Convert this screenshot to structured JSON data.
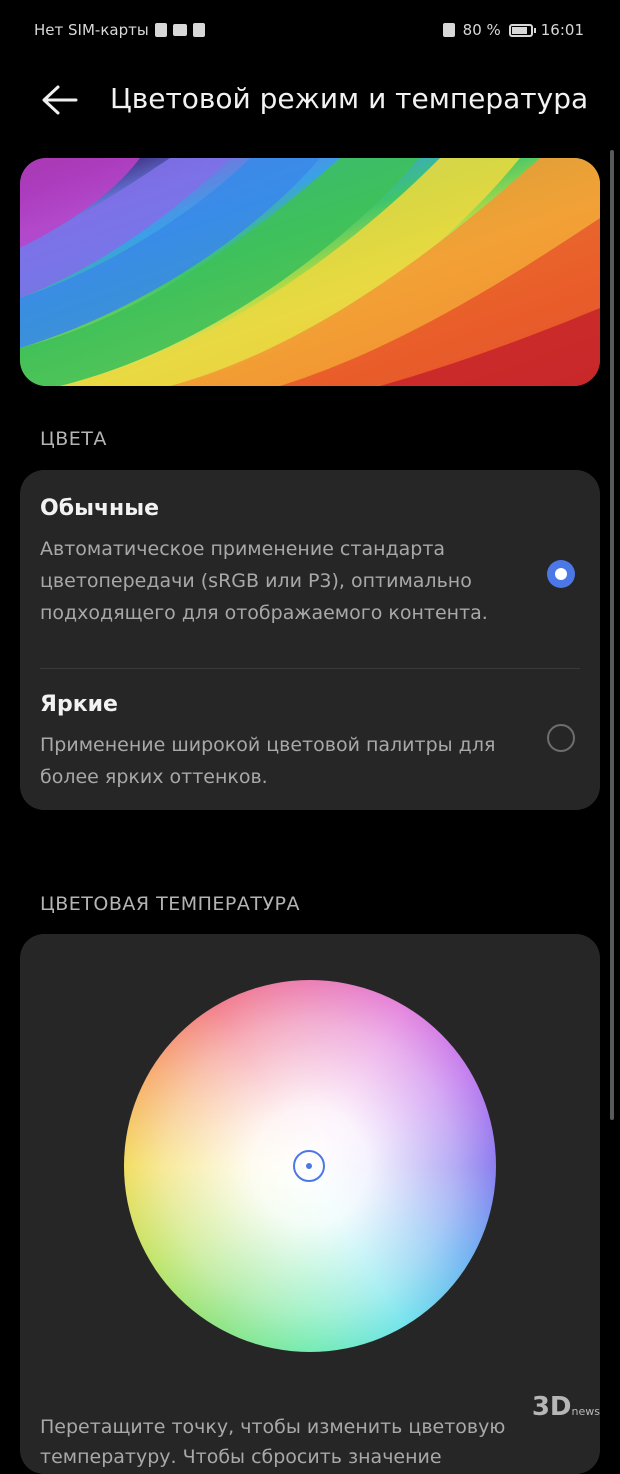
{
  "status_bar": {
    "sim_text": "Нет SIM-карты",
    "battery_percent": "80 %",
    "time": "16:01"
  },
  "header": {
    "title": "Цветовой режим и температура",
    "back_icon": "arrow-left-icon"
  },
  "colors_section": {
    "label": "ЦВЕТА",
    "options": [
      {
        "title": "Обычные",
        "description": "Автоматическое применение стандарта цветопередачи (sRGB или P3), оптимально подходящего для отображаемого контента.",
        "selected": true
      },
      {
        "title": "Яркие",
        "description": "Применение широкой цветовой палитры для более ярких оттенков.",
        "selected": false
      }
    ]
  },
  "temperature_section": {
    "label": "ЦВЕТОВАЯ ТЕМПЕРАТУРА",
    "hint": "Перетащите точку, чтобы изменить цветовую температуру. Чтобы сбросить значение"
  },
  "watermark": {
    "brand": "3D",
    "sub": "news"
  },
  "colors": {
    "accent": "#4b78e6",
    "background": "#000000",
    "card": "#262626"
  }
}
